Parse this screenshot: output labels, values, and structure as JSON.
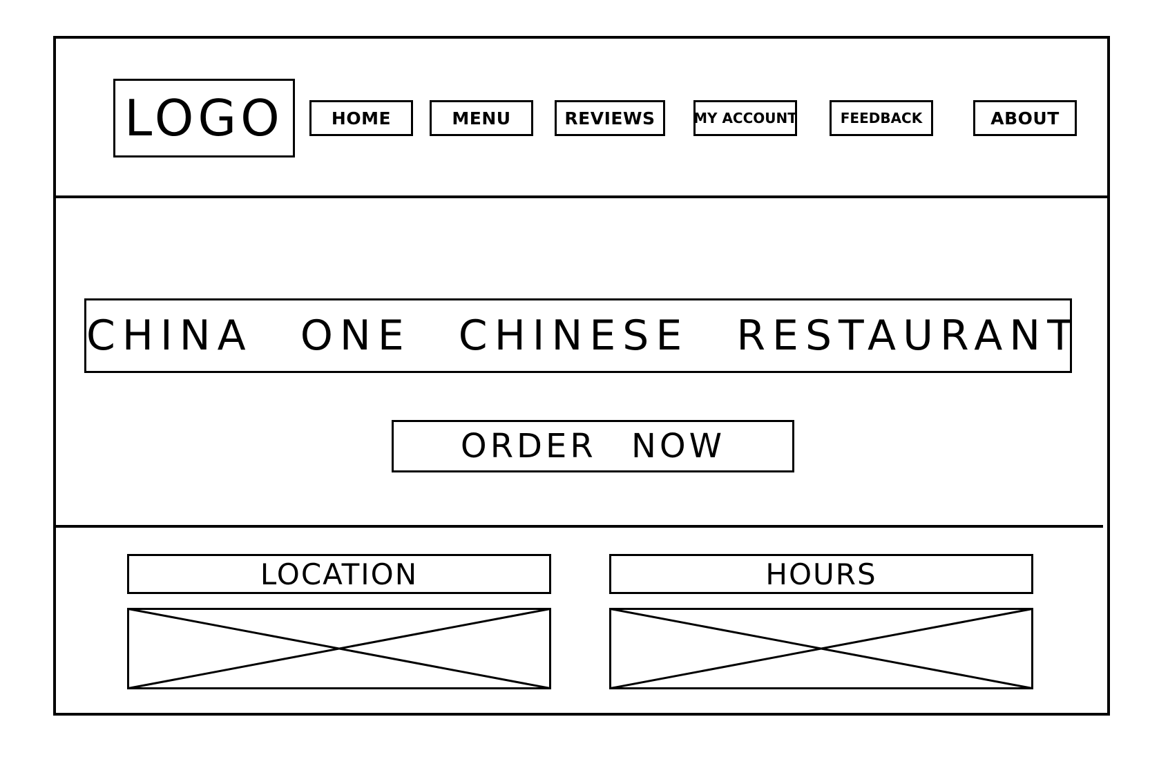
{
  "header": {
    "logo": "LOGO",
    "nav": [
      {
        "label": "HOME"
      },
      {
        "label": "MENU"
      },
      {
        "label": "REVIEWS"
      },
      {
        "label": "MY ACCOUNT"
      },
      {
        "label": "FEEDBACK"
      },
      {
        "label": "ABOUT"
      }
    ]
  },
  "hero": {
    "title": "CHINA ONE CHINESE RESTAURANT",
    "cta": "ORDER NOW"
  },
  "info": {
    "location_title": "LOCATION",
    "hours_title": "HOURS",
    "placeholder_icon": "image-placeholder-icon"
  },
  "colors": {
    "stroke": "#000000",
    "background": "#ffffff"
  }
}
